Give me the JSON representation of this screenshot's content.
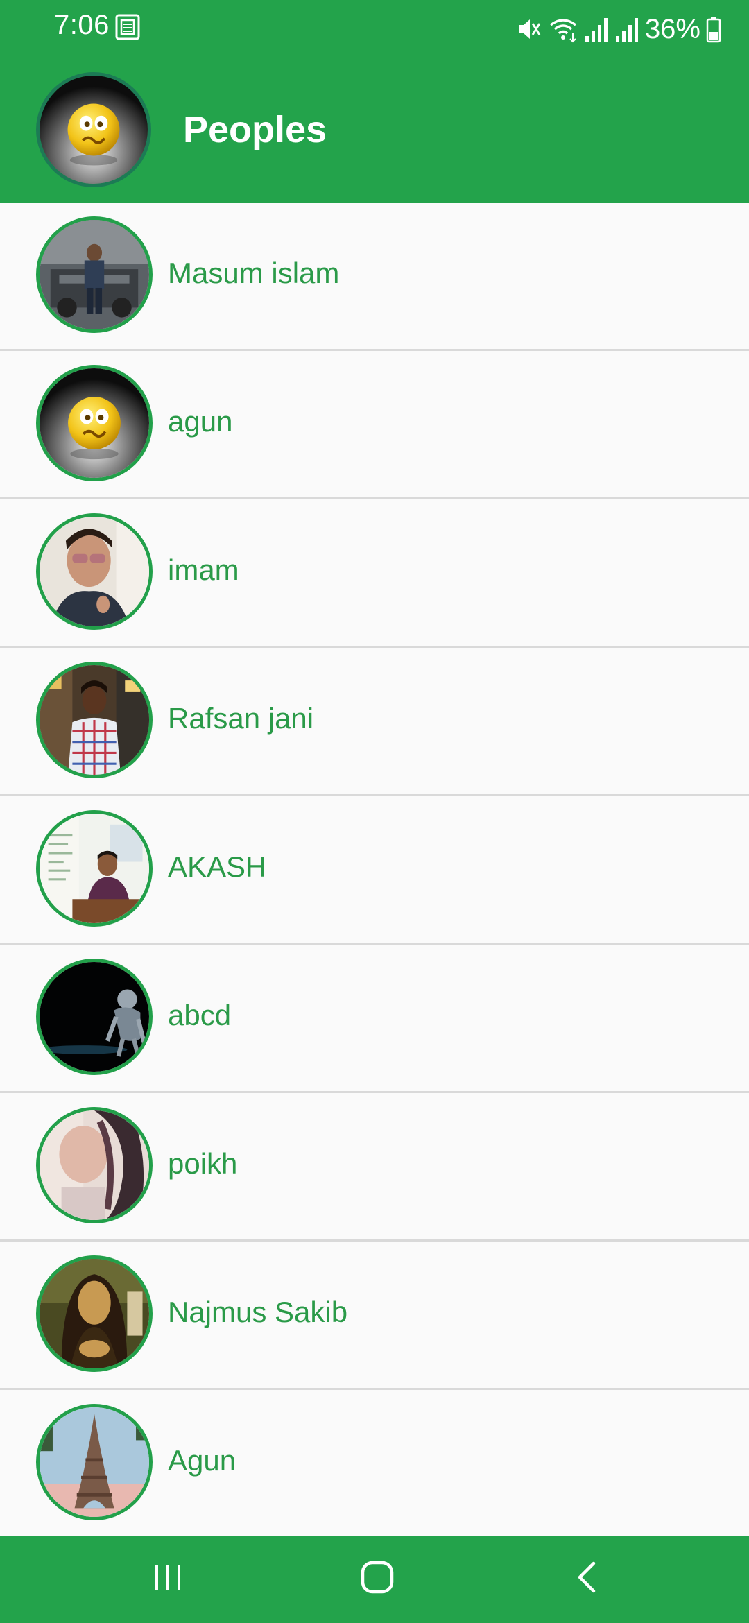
{
  "status_bar": {
    "time": "7:06",
    "battery_percent": "36%",
    "icons": [
      "notification-icon",
      "mute-icon",
      "wifi-icon",
      "signal-icon",
      "signal-icon",
      "battery-icon"
    ]
  },
  "app_bar": {
    "title": "Peoples",
    "avatar_icon": "profile-avatar"
  },
  "people": [
    {
      "name": "Masum islam"
    },
    {
      "name": "agun"
    },
    {
      "name": "imam"
    },
    {
      "name": "Rafsan jani"
    },
    {
      "name": "AKASH"
    },
    {
      "name": "abcd"
    },
    {
      "name": "poikh"
    },
    {
      "name": "Najmus Sakib"
    },
    {
      "name": "Agun"
    }
  ],
  "colors": {
    "primary": "#23a34b",
    "name_text": "#2a9a48",
    "avatar_border": "#22a04a",
    "divider": "#d9d9d9",
    "background": "#fafafa"
  },
  "nav_bar": {
    "buttons": [
      "recent-apps-icon",
      "home-icon",
      "back-icon"
    ]
  }
}
